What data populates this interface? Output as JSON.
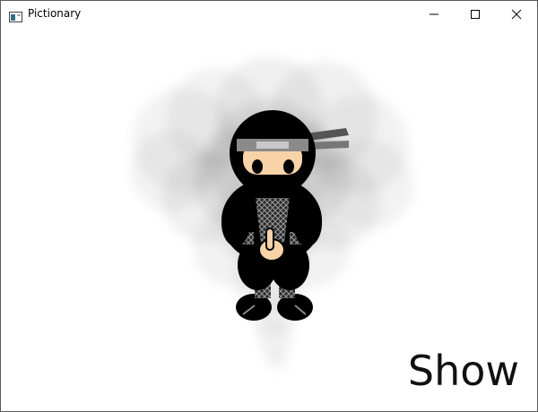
{
  "window": {
    "title": "Pictionary",
    "icon": "app-window-icon",
    "controls": [
      "minimize-icon",
      "maximize-icon",
      "close-icon"
    ]
  },
  "drawing": {
    "subject": "ninja",
    "smoke_color": "#000000",
    "body_color": "#000000",
    "skin_color": "#f8d3a8",
    "headband_color": "#8a8a8a"
  },
  "show_button": {
    "label": "Show"
  }
}
